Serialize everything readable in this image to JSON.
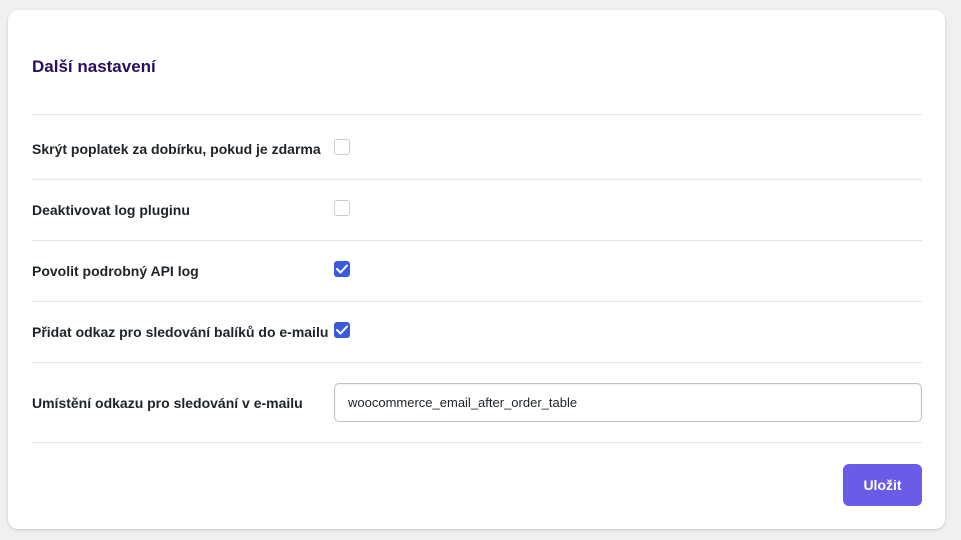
{
  "section": {
    "title": "Další nastavení"
  },
  "settings": [
    {
      "label": "Skrýt poplatek za dobírku, pokud je zdarma",
      "type": "checkbox",
      "checked": false
    },
    {
      "label": "Deaktivovat log pluginu",
      "type": "checkbox",
      "checked": false
    },
    {
      "label": "Povolit podrobný API log",
      "type": "checkbox",
      "checked": true
    },
    {
      "label": "Přidat odkaz pro sledování balíků do e-mailu",
      "type": "checkbox",
      "checked": true
    },
    {
      "label": "Umístění odkazu pro sledování v e-mailu",
      "type": "text",
      "value": "woocommerce_email_after_order_table"
    }
  ],
  "actions": {
    "save_label": "Uložit"
  },
  "colors": {
    "title": "#2a0f5c",
    "checkbox_checked": "#3c5bdb",
    "save_button": "#6b5ce7",
    "page_background": "#f0f0f1",
    "card_background": "#ffffff"
  }
}
